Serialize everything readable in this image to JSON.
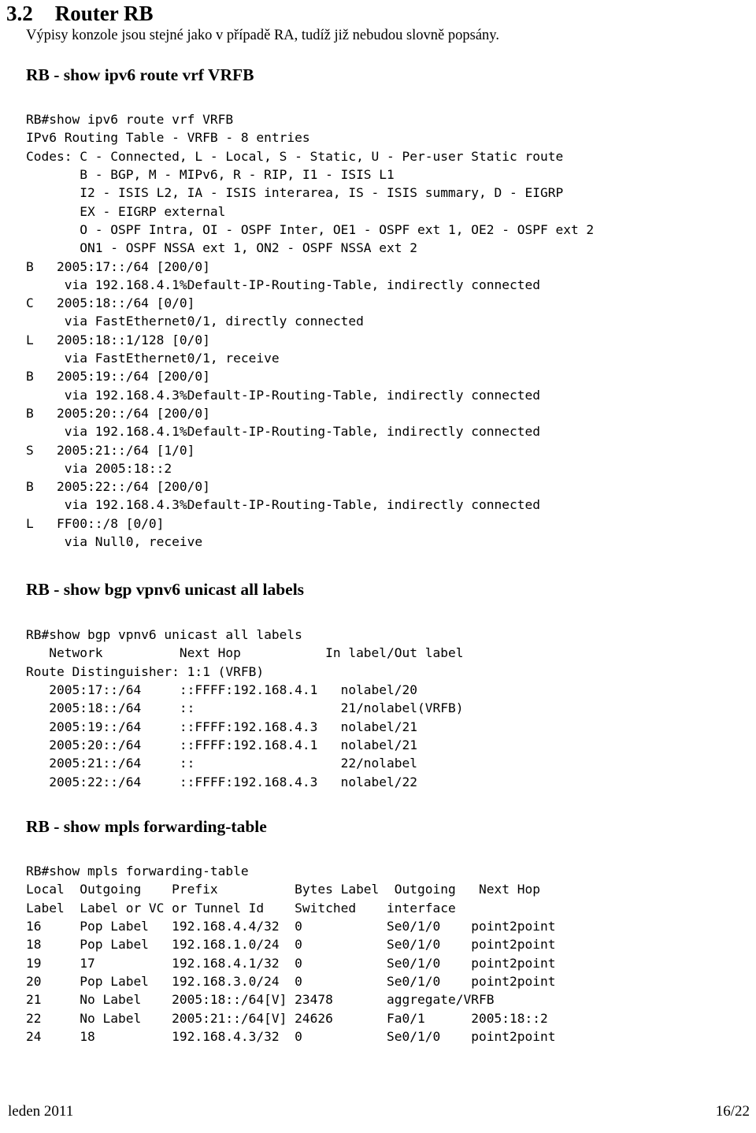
{
  "section": {
    "number": "3.2",
    "title": "Router RB"
  },
  "intro": "Výpisy konzole jsou stejné jako v případě RA, tudíž již nebudou slovně popsány.",
  "blocks": {
    "ipv6_route": {
      "heading": "RB - show ipv6 route vrf VRFB",
      "lines": [
        "RB#show ipv6 route vrf VRFB",
        "IPv6 Routing Table - VRFB - 8 entries",
        "Codes: C - Connected, L - Local, S - Static, U - Per-user Static route",
        "       B - BGP, M - MIPv6, R - RIP, I1 - ISIS L1",
        "       I2 - ISIS L2, IA - ISIS interarea, IS - ISIS summary, D - EIGRP",
        "       EX - EIGRP external",
        "       O - OSPF Intra, OI - OSPF Inter, OE1 - OSPF ext 1, OE2 - OSPF ext 2",
        "       ON1 - OSPF NSSA ext 1, ON2 - OSPF NSSA ext 2",
        "B   2005:17::/64 [200/0]",
        "     via 192.168.4.1%Default-IP-Routing-Table, indirectly connected",
        "C   2005:18::/64 [0/0]",
        "     via FastEthernet0/1, directly connected",
        "L   2005:18::1/128 [0/0]",
        "     via FastEthernet0/1, receive",
        "B   2005:19::/64 [200/0]",
        "     via 192.168.4.3%Default-IP-Routing-Table, indirectly connected",
        "B   2005:20::/64 [200/0]",
        "     via 192.168.4.1%Default-IP-Routing-Table, indirectly connected",
        "S   2005:21::/64 [1/0]",
        "     via 2005:18::2",
        "B   2005:22::/64 [200/0]",
        "     via 192.168.4.3%Default-IP-Routing-Table, indirectly connected",
        "L   FF00::/8 [0/0]",
        "     via Null0, receive"
      ]
    },
    "bgp_labels": {
      "heading": "RB - show bgp vpnv6 unicast all labels",
      "lines": [
        "RB#show bgp vpnv6 unicast all labels",
        "   Network          Next Hop           In label/Out label",
        "Route Distinguisher: 1:1 (VRFB)",
        "   2005:17::/64     ::FFFF:192.168.4.1   nolabel/20",
        "   2005:18::/64     ::                   21/nolabel(VRFB)",
        "   2005:19::/64     ::FFFF:192.168.4.3   nolabel/21",
        "   2005:20::/64     ::FFFF:192.168.4.1   nolabel/21",
        "   2005:21::/64     ::                   22/nolabel",
        "   2005:22::/64     ::FFFF:192.168.4.3   nolabel/22"
      ]
    },
    "mpls_forwarding": {
      "heading": "RB - show mpls forwarding-table",
      "lines": [
        "RB#show mpls forwarding-table",
        "Local  Outgoing    Prefix          Bytes Label  Outgoing   Next Hop",
        "Label  Label or VC or Tunnel Id    Switched    interface",
        "16     Pop Label   192.168.4.4/32  0           Se0/1/0    point2point",
        "18     Pop Label   192.168.1.0/24  0           Se0/1/0    point2point",
        "19     17          192.168.4.1/32  0           Se0/1/0    point2point",
        "20     Pop Label   192.168.3.0/24  0           Se0/1/0    point2point",
        "21     No Label    2005:18::/64[V] 23478       aggregate/VRFB",
        "22     No Label    2005:21::/64[V] 24626       Fa0/1      2005:18::2",
        "24     18          192.168.4.3/32  0           Se0/1/0    point2point"
      ]
    }
  },
  "footer": {
    "left": "leden 2011",
    "right": "16/22"
  }
}
